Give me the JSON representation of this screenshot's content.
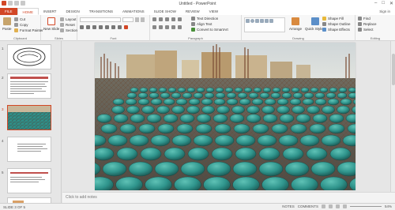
{
  "window": {
    "title": "Untitled - PowerPoint",
    "min_glyph": "–",
    "max_glyph": "□",
    "close_glyph": "✕"
  },
  "tabs": [
    "FILE",
    "HOME",
    "INSERT",
    "DESIGN",
    "TRANSITIONS",
    "ANIMATIONS",
    "SLIDE SHOW",
    "REVIEW",
    "VIEW"
  ],
  "user": "Sign in",
  "ribbon": {
    "clipboard": {
      "label": "Clipboard",
      "paste": "Paste",
      "cut": "Cut",
      "copy": "Copy",
      "format_painter": "Format Painter"
    },
    "slides": {
      "label": "Slides",
      "new_slide": "New Slide",
      "layout": "Layout",
      "reset": "Reset",
      "section": "Section"
    },
    "font": {
      "label": "Font"
    },
    "paragraph": {
      "label": "Paragraph",
      "text_direction": "Text Direction",
      "align_text": "Align Text",
      "smartart": "Convert to SmartArt"
    },
    "drawing": {
      "label": "Drawing",
      "arrange": "Arrange",
      "quick_styles": "Quick Styles",
      "shape_fill": "Shape Fill",
      "shape_outline": "Shape Outline",
      "shape_effects": "Shape Effects"
    },
    "editing": {
      "label": "Editing",
      "find": "Find",
      "replace": "Replace",
      "select": "Select"
    }
  },
  "thumbnails": [
    {
      "num": "1"
    },
    {
      "num": "2"
    },
    {
      "num": "3"
    },
    {
      "num": "4"
    },
    {
      "num": "5"
    }
  ],
  "notes_placeholder": "Click to add notes",
  "status": {
    "slide_info": "SLIDE 3 OF 5",
    "notes": "NOTES",
    "comments": "COMMENTS",
    "zoom": "54%"
  }
}
